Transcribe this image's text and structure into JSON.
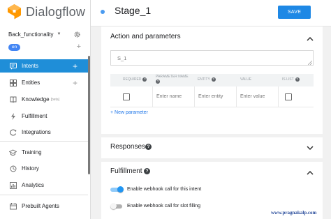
{
  "app": {
    "name": "Dialogflow"
  },
  "sidebar": {
    "agent_name": "Back_functionality",
    "language": "en",
    "items": [
      {
        "label": "Intents",
        "icon": "chat-bubble-icon",
        "active": true
      },
      {
        "label": "Entities",
        "icon": "entities-icon"
      },
      {
        "label": "Knowledge",
        "badge": "[beta]",
        "icon": "knowledge-icon"
      },
      {
        "label": "Fulfillment",
        "icon": "lightning-icon"
      },
      {
        "label": "Integrations",
        "icon": "integrations-icon"
      },
      {
        "label": "Training",
        "icon": "training-icon"
      },
      {
        "label": "History",
        "icon": "history-icon"
      },
      {
        "label": "Analytics",
        "icon": "analytics-icon"
      },
      {
        "label": "Prebuilt Agents",
        "icon": "prebuilt-agents-icon"
      }
    ]
  },
  "header": {
    "title": "Stage_1",
    "save_label": "SAVE"
  },
  "action_params": {
    "title": "Action and parameters",
    "action_value": "S_1",
    "columns": {
      "required": "REQUIRED",
      "param_name": "PARAMETER NAME",
      "entity": "ENTITY",
      "value": "VALUE",
      "is_list": "IS LIST"
    },
    "row": {
      "name_placeholder": "Enter name",
      "entity_placeholder": "Enter entity",
      "value_placeholder": "Enter value"
    },
    "new_param_label": "+ New parameter"
  },
  "responses": {
    "title": "Responses"
  },
  "fulfillment": {
    "title": "Fulfillment",
    "toggles": [
      {
        "label": "Enable webhook call for this intent",
        "on": true
      },
      {
        "label": "Enable webhook call for slot filling",
        "on": false
      }
    ]
  },
  "watermark": "www.pragnakalp.com",
  "colors": {
    "accent": "#1e88e5",
    "active_nav": "#1f8ed8",
    "toggle_on": "#2196f3"
  }
}
